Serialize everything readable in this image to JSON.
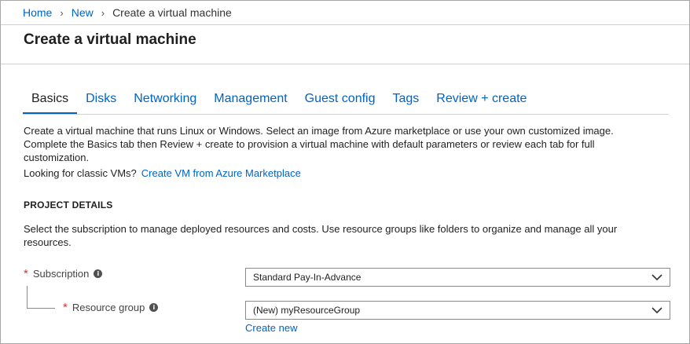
{
  "breadcrumb": {
    "items": [
      "Home",
      "New"
    ],
    "current": "Create a virtual machine"
  },
  "page": {
    "title": "Create a virtual machine"
  },
  "tabs": [
    {
      "label": "Basics",
      "active": true
    },
    {
      "label": "Disks",
      "active": false
    },
    {
      "label": "Networking",
      "active": false
    },
    {
      "label": "Management",
      "active": false
    },
    {
      "label": "Guest config",
      "active": false
    },
    {
      "label": "Tags",
      "active": false
    },
    {
      "label": "Review + create",
      "active": false
    }
  ],
  "intro": {
    "description": "Create a virtual machine that runs Linux or Windows. Select an image from Azure marketplace or use your own customized image. Complete the Basics tab then Review + create to provision a virtual machine with default parameters or review each tab for full customization.",
    "classic_prompt": "Looking for classic VMs?",
    "classic_link": "Create VM from Azure Marketplace"
  },
  "project_details": {
    "title": "PROJECT DETAILS",
    "description": "Select the subscription to manage deployed resources and costs. Use resource groups like folders to organize and manage all your resources.",
    "subscription": {
      "label": "Subscription",
      "required_mark": "*",
      "value": "Standard Pay-In-Advance"
    },
    "resource_group": {
      "label": "Resource group",
      "required_mark": "*",
      "value": "(New) myResourceGroup",
      "create_new": "Create new"
    }
  },
  "colors": {
    "accent": "#0063c6",
    "required": "#d13438"
  }
}
